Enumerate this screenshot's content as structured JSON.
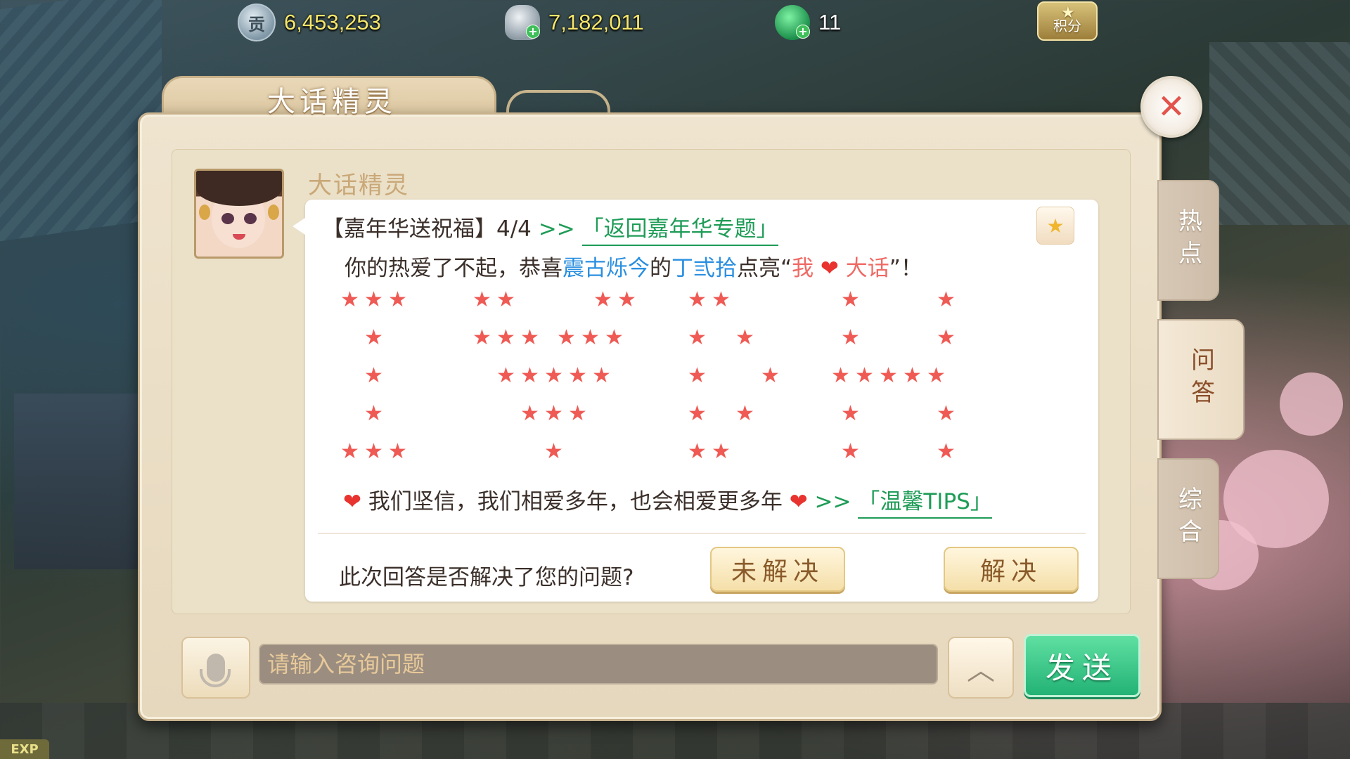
{
  "currencies": {
    "contribution": {
      "icon": "gong-coin-icon",
      "glyph": "贡",
      "value": "6,453,253"
    },
    "silver": {
      "icon": "silver-ingot-icon",
      "value": "7,182,011"
    },
    "jade": {
      "icon": "jade-icon",
      "value": "11"
    },
    "score": {
      "icon": "score-badge-icon",
      "label": "积分"
    }
  },
  "dialog": {
    "title": "大话精灵",
    "close_glyph": "✕",
    "sender_name": "大话精灵",
    "message": {
      "head_prefix": "【嘉年华送祝福】4/4",
      "head_arrow": " >> ",
      "head_link": "「返回嘉年华专题」",
      "line1_a": "你的热爱了不起，恭喜",
      "line1_server": "震古烁今",
      "line1_b": "的",
      "line1_player": "丁弎拾",
      "line1_c": "点亮“",
      "line1_wo": "我",
      "line1_heart": "❤",
      "line1_dahua": "大话",
      "line1_d": "”！",
      "footer_heart": "❤",
      "footer_text": "我们坚信，我们相爱多年，也会相爱更多年",
      "footer_heart2": "❤",
      "footer_arrow": " >> ",
      "footer_link": "「温馨TIPS」"
    },
    "feedback": {
      "question": "此次回答是否解决了您的问题?",
      "unresolved": "未解决",
      "resolved": "解决"
    }
  },
  "side_tabs": [
    {
      "label": "热点",
      "active": false
    },
    {
      "label": "问答",
      "active": true
    },
    {
      "label": "综合",
      "active": false
    }
  ],
  "input_bar": {
    "placeholder": "请输入咨询问题",
    "expand_glyph": "︿",
    "send_label": "发送"
  },
  "exp_label": "EXP",
  "colors": {
    "accent_green": "#23b275",
    "link_green": "#1f9c57",
    "highlight_blue": "#2a8fe0",
    "star_red": "#ef5a54"
  }
}
